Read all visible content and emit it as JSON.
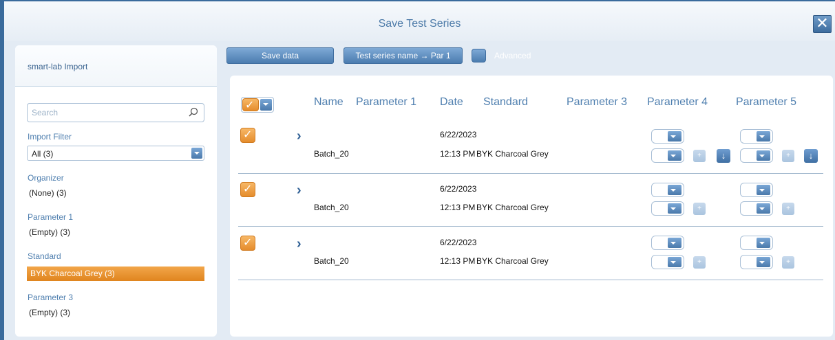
{
  "window": {
    "title": "Save Test Series",
    "close_label": "✕"
  },
  "left": {
    "heading": "smart-lab Import",
    "search_placeholder": "Search",
    "import_filter": {
      "label": "Import Filter",
      "value": "All (3)"
    },
    "organizer": {
      "label": "Organizer",
      "value": "(None) (3)"
    },
    "parameter1": {
      "label": "Parameter 1",
      "value": "(Empty) (3)"
    },
    "standard": {
      "label": "Standard",
      "value": "BYK Charcoal Grey (3)"
    },
    "parameter3": {
      "label": "Parameter 3",
      "value": "(Empty) (3)"
    }
  },
  "toolbar": {
    "save_label": "Save data",
    "naming_label": "Test series name → Par 1",
    "advanced_label": "Advanced"
  },
  "table": {
    "columns": [
      "Name",
      "Parameter 1",
      "Date",
      "Standard",
      "Parameter 3",
      "Parameter 4",
      "Parameter 5"
    ],
    "rows": [
      {
        "name": "Batch_20",
        "date": "6/22/2023",
        "time": "12:13 PM",
        "standard": "BYK Charcoal Grey"
      },
      {
        "name": "Batch_20",
        "date": "6/22/2023",
        "time": "12:13 PM",
        "standard": "BYK Charcoal Grey"
      },
      {
        "name": "Batch_20",
        "date": "6/22/2023",
        "time": "12:13 PM",
        "standard": "BYK Charcoal Grey"
      }
    ],
    "plus_label": "+",
    "down_label": "↓"
  },
  "colors": {
    "accent": "#4b7caf",
    "selected": "#e58c2c"
  }
}
